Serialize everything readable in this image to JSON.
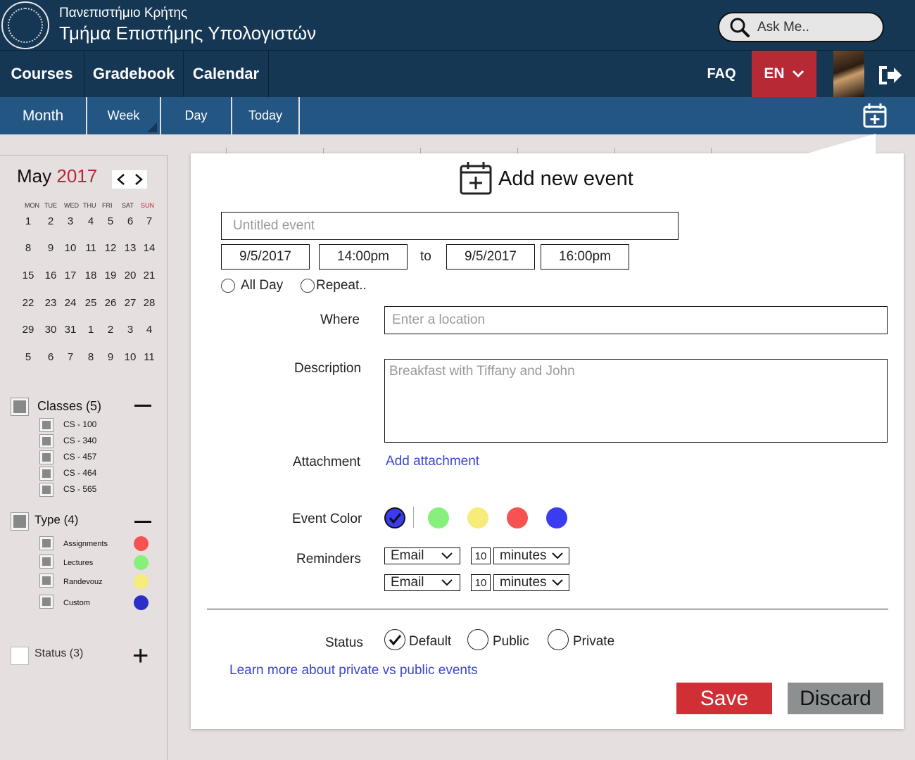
{
  "header": {
    "university": "Πανεπιστήμιο Κρήτης",
    "department": "Τμήμα Επιστήμης Υπολογιστών",
    "search_placeholder": "Ask Me.."
  },
  "nav": {
    "items": [
      "Courses",
      "Gradebook",
      "Calendar"
    ],
    "faq": "FAQ",
    "language": "EN"
  },
  "subnav": {
    "items": [
      "Month",
      "Week",
      "Day",
      "Today"
    ]
  },
  "mini_calendar": {
    "month": "May",
    "year": "2017",
    "weekdays": [
      "MON",
      "TUE",
      "WED",
      "THU",
      "FRI",
      "SAT",
      "SUN"
    ],
    "weeks": [
      [
        "1",
        "2",
        "3",
        "4",
        "5",
        "6",
        "7"
      ],
      [
        "8",
        "9",
        "10",
        "11",
        "12",
        "13",
        "14"
      ],
      [
        "15",
        "16",
        "17",
        "18",
        "19",
        "20",
        "21"
      ],
      [
        "22",
        "23",
        "24",
        "25",
        "26",
        "27",
        "28"
      ],
      [
        "29",
        "30",
        "31",
        "1",
        "2",
        "3",
        "4"
      ],
      [
        "5",
        "6",
        "7",
        "8",
        "9",
        "10",
        "11"
      ]
    ]
  },
  "filters": {
    "classes": {
      "label": "Classes (5)",
      "items": [
        "CS - 100",
        "CS - 340",
        "CS - 457",
        "CS - 464",
        "CS - 565"
      ]
    },
    "type": {
      "label": "Type (4)",
      "items": [
        {
          "label": "Assignments",
          "color": "#f65252"
        },
        {
          "label": "Lectures",
          "color": "#86f07a"
        },
        {
          "label": "Randevouz",
          "color": "#f6ec7a"
        },
        {
          "label": "Custom",
          "color": "#2b2fc7"
        }
      ]
    },
    "status": {
      "label": "Status (3)"
    }
  },
  "form": {
    "title": "Add new event",
    "title_placeholder": "Untitled event",
    "start_date": "9/5/2017",
    "start_time": "14:00pm",
    "to_label": "to",
    "end_date": "9/5/2017",
    "end_time": "16:00pm",
    "all_day_label": "All Day",
    "repeat_label": "Repeat..",
    "where_label": "Where",
    "where_placeholder": "Enter a location",
    "description_label": "Description",
    "description_placeholder": "Breakfast with Tiffany and John",
    "attachment_label": "Attachment",
    "attachment_link": "Add attachment",
    "event_color_label": "Event Color",
    "event_colors": [
      "#3b3bf2",
      "#86f07a",
      "#f6ec7a",
      "#f65252",
      "#3b3bf2"
    ],
    "reminders_label": "Reminders",
    "reminders": [
      {
        "method": "Email",
        "amount": "10",
        "unit": "minutes"
      },
      {
        "method": "Email",
        "amount": "10",
        "unit": "minutes"
      }
    ],
    "status_label": "Status",
    "status_options": [
      "Default",
      "Public",
      "Private"
    ],
    "learn_more_link": "Learn more about private vs public events",
    "save_label": "Save",
    "discard_label": "Discard"
  },
  "colors": {
    "header_bg": "#163753",
    "subnav_bg": "#245684",
    "accent_red": "#b72935",
    "save_bg": "#d03035",
    "discard_bg": "#8c9090"
  }
}
